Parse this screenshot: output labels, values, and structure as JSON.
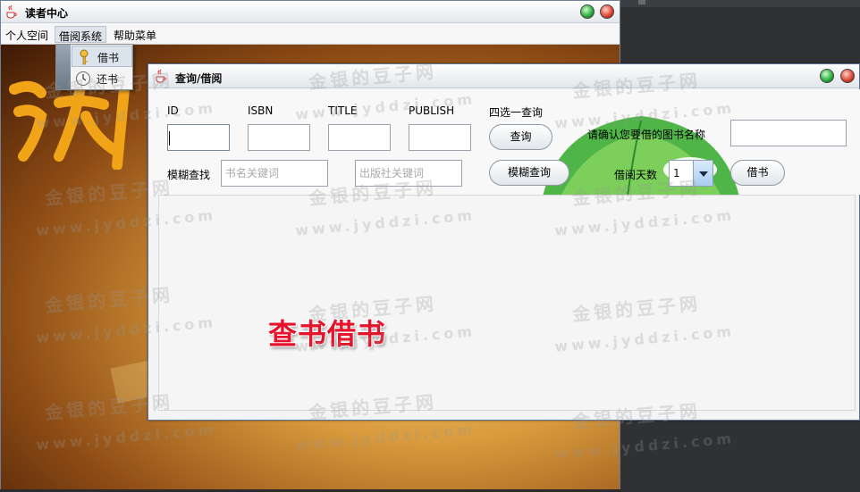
{
  "main_window": {
    "title": "读者中心"
  },
  "menubar": {
    "items": [
      "个人空间",
      "借阅系统",
      "帮助菜单"
    ]
  },
  "dropdown": {
    "items": [
      "借书",
      "还书"
    ]
  },
  "query_window": {
    "title": "查询/借阅",
    "labels": {
      "id": "ID",
      "isbn": "ISBN",
      "title": "TITLE",
      "publish": "PUBLISH",
      "choose_one": "四选一查询",
      "fuzzy": "模糊查找",
      "confirm_name": "请确认您要借的图书名称",
      "borrow_days": "借阅天数"
    },
    "buttons": {
      "query": "查询",
      "fuzzy_query": "模糊查询",
      "borrow": "借书"
    },
    "placeholders": {
      "book_keyword": "书名关键词",
      "publisher_keyword": "出版社关键词"
    },
    "borrow_days_value": "1",
    "caption": "查书借书"
  },
  "watermark": {
    "brand": "金银的豆子网",
    "site": "www.jyddzi.com"
  },
  "colors": {
    "caption_red": "#e3142b",
    "title_bar": "#e4e8ec",
    "window_border": "#5d7391"
  }
}
